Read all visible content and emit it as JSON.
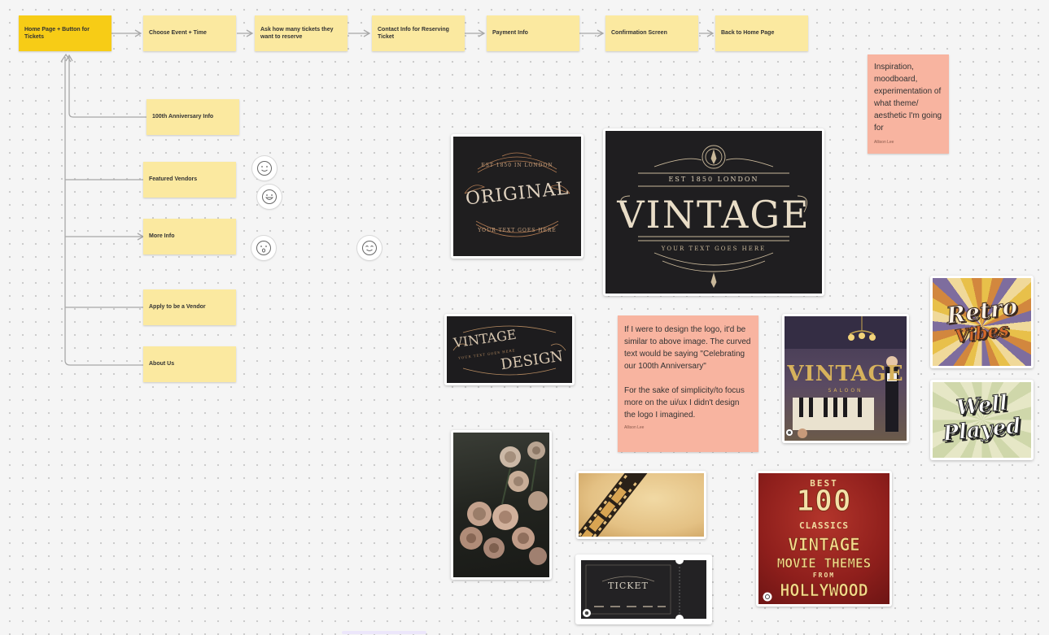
{
  "flow": {
    "home": "Home Page + Button for Tickets",
    "steps": [
      "Choose Event + Time",
      "Ask how many tickets they want to reserve",
      "Contact Info for Reserving Ticket",
      "Payment Info",
      "Confirmation Screen",
      "Back to Home Page"
    ],
    "sub": [
      "100th Anniversary Info",
      "Featured Vendors",
      "More Info",
      "Apply to be a Vendor",
      "About Us"
    ]
  },
  "notes": {
    "inspiration": {
      "text": "Inspiration, moodboard, experimentation of what theme/ aesthetic I'm going for",
      "author": "Allison Lee"
    },
    "logo": {
      "text": "If I were to design the logo, it'd be similar to above image. The curved text would be saying \"Celebrating our 100th Anniversary\"\n\nFor the sake of simplicity/to focus more on the ui/ux I didn't design the logo I imagined.",
      "author": "Allison Lee"
    }
  },
  "images": {
    "original": {
      "top": "EST 1850 IN LONDON",
      "main": "ORIGINAL",
      "bottom": "YOUR TEXT GOES HERE"
    },
    "vintage": {
      "top": "EST 1850 LONDON",
      "main": "VINTAGE",
      "bottom": "YOUR TEXT GOES HERE"
    },
    "vintage_design": {
      "line1": "VINTAGE",
      "line2": "DESIGN",
      "small": "YOUR TEXT GOES HERE"
    },
    "saloon": {
      "main": "VINTAGE",
      "sub": "SALOON"
    },
    "retro": {
      "line1": "Retro",
      "line2": "Vibes"
    },
    "well_played": {
      "line1": "Well",
      "line2": "Played"
    },
    "ticket": {
      "label": "TICKET"
    },
    "hollywood": {
      "best": "BEST",
      "num": "100",
      "classics": "CLASSICS",
      "line1": "VINTAGE",
      "line2": "MOVIE THEMES",
      "from": "FROM",
      "line3": "HOLLYWOOD"
    }
  },
  "colors": {
    "sticky": "#fbe9a0",
    "sticky_primary": "#f7cc16",
    "note": "#f8b4a0",
    "connector": "#a8a8a8"
  }
}
